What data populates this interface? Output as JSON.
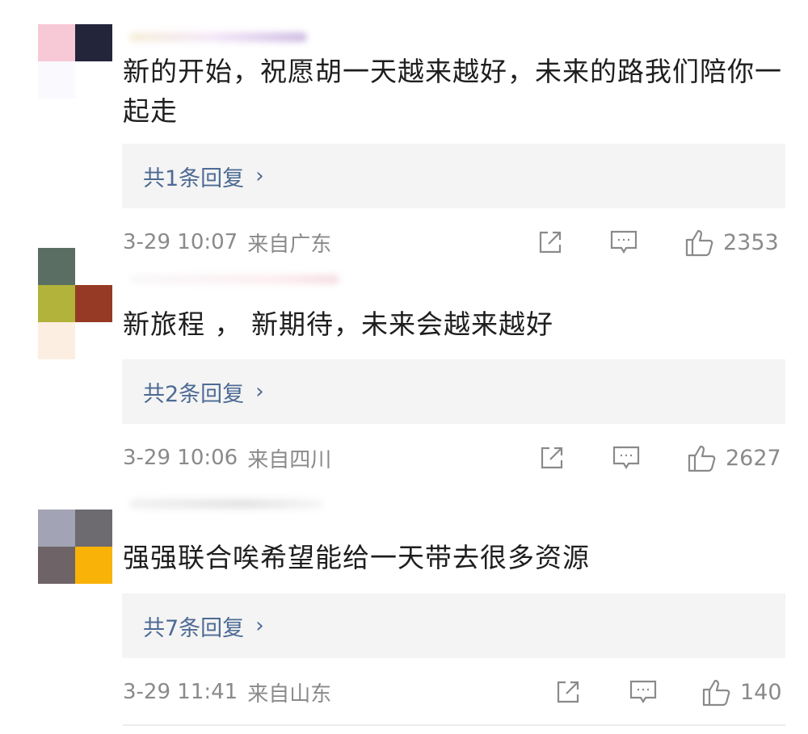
{
  "comments": [
    {
      "avatar_colors": [
        "#f7c8d6",
        "#23263b",
        "#fafafe",
        "#ffffff"
      ],
      "username_color": "#b9a0d8",
      "text": "新的开始，祝愿胡一天越来越好，未来的路我们陪你一起走",
      "replies": "共1条回复",
      "time": "3-29 10:07",
      "location": "来自广东",
      "likes": "2353"
    },
    {
      "avatar_colors": [
        "#5a6e63",
        "#ffffff",
        "#b2b33a",
        "#973a25",
        "#fdeee2",
        "#ffffff"
      ],
      "username_color": "#f0d0d8",
      "text": "新旅程 ， 新期待，未来会越来越好",
      "replies": "共2条回复",
      "time": "3-29 10:06",
      "location": "来自四川",
      "likes": "2627"
    },
    {
      "avatar_colors": [
        "#a2a3b4",
        "#6d6b70",
        "#6e6467",
        "#f9b208"
      ],
      "username_color": "#d8d8d8",
      "text": "强强联合唉希望能给一天带去很多资源",
      "replies": "共7条回复",
      "time": "3-29 11:41",
      "location": "来自山东",
      "likes": "140"
    }
  ],
  "icons": {
    "share": "share-icon",
    "comment": "comment-icon",
    "like": "thumbs-up-icon"
  },
  "colors": {
    "reply_link": "#4d6a94",
    "meta_text": "#8a8a8a",
    "reply_bg": "#f4f4f4"
  }
}
